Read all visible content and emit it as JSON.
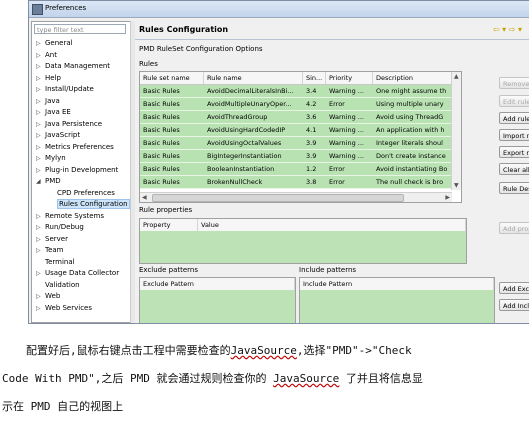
{
  "window": {
    "title": "Preferences"
  },
  "filter": {
    "placeholder": "type filter text"
  },
  "tree": [
    {
      "label": "General",
      "twisty": "▷",
      "indent": 0
    },
    {
      "label": "Ant",
      "twisty": "▷",
      "indent": 0
    },
    {
      "label": "Data Management",
      "twisty": "▷",
      "indent": 0
    },
    {
      "label": "Help",
      "twisty": "▷",
      "indent": 0
    },
    {
      "label": "Install/Update",
      "twisty": "▷",
      "indent": 0
    },
    {
      "label": "Java",
      "twisty": "▷",
      "indent": 0
    },
    {
      "label": "Java EE",
      "twisty": "▷",
      "indent": 0
    },
    {
      "label": "Java Persistence",
      "twisty": "▷",
      "indent": 0
    },
    {
      "label": "JavaScript",
      "twisty": "▷",
      "indent": 0
    },
    {
      "label": "Metrics Preferences",
      "twisty": "▷",
      "indent": 0
    },
    {
      "label": "Mylyn",
      "twisty": "▷",
      "indent": 0
    },
    {
      "label": "Plug-in Development",
      "twisty": "▷",
      "indent": 0
    },
    {
      "label": "PMD",
      "twisty": "◢",
      "indent": 0
    },
    {
      "label": "CPD Preferences",
      "twisty": "",
      "indent": 1
    },
    {
      "label": "Rules Configuration",
      "twisty": "",
      "indent": 1,
      "selected": true
    },
    {
      "label": "Remote Systems",
      "twisty": "▷",
      "indent": 0
    },
    {
      "label": "Run/Debug",
      "twisty": "▷",
      "indent": 0
    },
    {
      "label": "Server",
      "twisty": "▷",
      "indent": 0
    },
    {
      "label": "Team",
      "twisty": "▷",
      "indent": 0
    },
    {
      "label": "Terminal",
      "twisty": "",
      "indent": 0
    },
    {
      "label": "Usage Data Collector",
      "twisty": "▷",
      "indent": 0
    },
    {
      "label": "Validation",
      "twisty": "",
      "indent": 0
    },
    {
      "label": "Web",
      "twisty": "▷",
      "indent": 0
    },
    {
      "label": "Web Services",
      "twisty": "▷",
      "indent": 0
    }
  ],
  "page": {
    "header": "Rules Configuration",
    "subtitle": "PMD RuleSet Configuration Options",
    "rules_label": "Rules",
    "rule_properties_label": "Rule properties",
    "exclude_label": "Exclude patterns",
    "include_label": "Include patterns",
    "exclude_header": "Exclude Pattern",
    "include_header": "Include Pattern",
    "prop_headers": [
      "Property",
      "Value"
    ]
  },
  "table": {
    "headers": [
      "Rule set name",
      "Rule name",
      "Sin...",
      "Priority",
      "Description"
    ],
    "rows": [
      [
        "Basic Rules",
        "AvoidDecimalLiteralsInBi...",
        "3.4",
        "Warning ...",
        "One might assume th"
      ],
      [
        "Basic Rules",
        "AvoidMultipleUnaryOper...",
        "4.2",
        "Error",
        "Using multiple unary"
      ],
      [
        "Basic Rules",
        "AvoidThreadGroup",
        "3.6",
        "Warning ...",
        "Avoid using ThreadG"
      ],
      [
        "Basic Rules",
        "AvoidUsingHardCodedIP",
        "4.1",
        "Warning ...",
        "An application with h"
      ],
      [
        "Basic Rules",
        "AvoidUsingOctalValues",
        "3.9",
        "Warning ...",
        "Integer literals shoul"
      ],
      [
        "Basic Rules",
        "BigIntegerInstantiation",
        "3.9",
        "Warning ...",
        "Don't create instance"
      ],
      [
        "Basic Rules",
        "BooleanInstantiation",
        "1.2",
        "Error",
        "Avoid instantiating Bo"
      ],
      [
        "Basic Rules",
        "BrokenNullCheck",
        "3.8",
        "Error",
        "The null check is bro"
      ]
    ]
  },
  "buttons": {
    "remove_rule": "Remove rule",
    "edit_rule": "Edit rule...",
    "add_rule": "Add rule...",
    "import": "Import rule set...",
    "export": "Export rule set...",
    "clear": "Clear all",
    "designer": "Rule Designer",
    "add_property": "Add property...",
    "add_exclude": "Add Exclude Pattern",
    "add_include": "Add Include Pattern"
  },
  "caption": {
    "line1_a": "配置好后,鼠标右键点击工程中需要检查的",
    "line1_b": "JavaSource",
    "line1_c": ",选择\"PMD\"->\"Check",
    "line2_a": "Code With PMD\",之后 PMD 就会通过规则检查你的 ",
    "line2_b": "JavaSource",
    "line2_c": " 了并且将信息显",
    "line3": "示在 PMD 自己的视图上"
  }
}
